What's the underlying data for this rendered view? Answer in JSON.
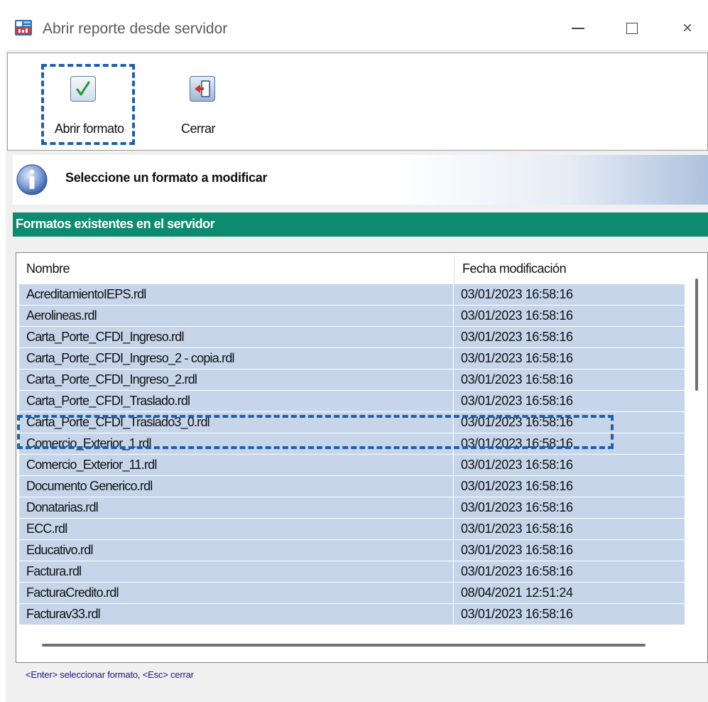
{
  "window": {
    "title": "Abrir reporte desde servidor",
    "icon": "app-report-icon",
    "controls": {
      "minimize": "minimize-icon",
      "maximize": "maximize-icon",
      "close": "×"
    }
  },
  "toolbar": {
    "open_label": "Abrir formato",
    "open_icon": "check-icon",
    "close_label": "Cerrar",
    "close_icon": "exit-door-icon"
  },
  "info": {
    "icon": "info-icon",
    "message": "Seleccione un formato a modificar"
  },
  "section": {
    "title": "Formatos existentes en el servidor"
  },
  "table": {
    "columns": [
      "Nombre",
      "Fecha modificación"
    ],
    "rows": [
      {
        "name": "AcreditamientoIEPS.rdl",
        "date": "03/01/2023 16:58:16"
      },
      {
        "name": "Aerolineas.rdl",
        "date": "03/01/2023 16:58:16"
      },
      {
        "name": "Carta_Porte_CFDI_Ingreso.rdl",
        "date": "03/01/2023 16:58:16"
      },
      {
        "name": "Carta_Porte_CFDI_Ingreso_2 - copia.rdl",
        "date": "03/01/2023 16:58:16"
      },
      {
        "name": "Carta_Porte_CFDI_Ingreso_2.rdl",
        "date": "03/01/2023 16:58:16"
      },
      {
        "name": "Carta_Porte_CFDI_Traslado.rdl",
        "date": "03/01/2023 16:58:16"
      },
      {
        "name": "Carta_Porte_CFDI_Traslado3_0.rdl",
        "date": "03/01/2023 16:58:16"
      },
      {
        "name": "Comercio_Exterior_1.rdl",
        "date": "03/01/2023 16:58:16"
      },
      {
        "name": "Comercio_Exterior_11.rdl",
        "date": "03/01/2023 16:58:16"
      },
      {
        "name": "Documento Generico.rdl",
        "date": "03/01/2023 16:58:16"
      },
      {
        "name": "Donatarias.rdl",
        "date": "03/01/2023 16:58:16"
      },
      {
        "name": "ECC.rdl",
        "date": "03/01/2023 16:58:16"
      },
      {
        "name": "Educativo.rdl",
        "date": "03/01/2023 16:58:16"
      },
      {
        "name": "Factura.rdl",
        "date": "03/01/2023 16:58:16"
      },
      {
        "name": "FacturaCredito.rdl",
        "date": "08/04/2021 12:51:24"
      },
      {
        "name": "Facturav33.rdl",
        "date": "03/01/2023 16:58:16"
      }
    ],
    "highlighted_row": "Carta_Porte_CFDI_Traslado3_0.rdl"
  },
  "status_hint": "<Enter> seleccionar formato, <Esc> cerrar",
  "colors": {
    "header_green": "#0c8b6e",
    "row_blue": "#c6d5ea",
    "highlight_dash": "#1f5fa8",
    "hint_text": "#1a1a8c"
  }
}
